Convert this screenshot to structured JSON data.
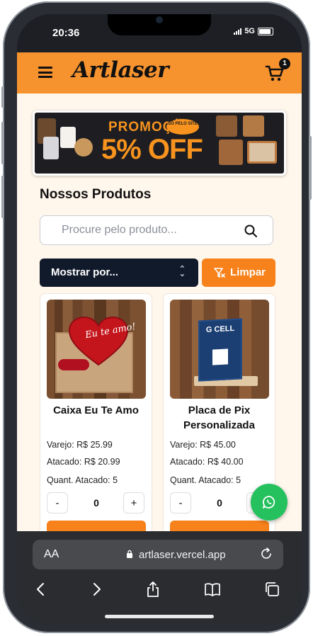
{
  "status": {
    "time": "20:36",
    "network": "5G"
  },
  "nav": {
    "logo": "Artlaser",
    "cart_count": "1"
  },
  "banner": {
    "title": "PROMOÇÃO",
    "big": "5% OFF",
    "small": "SÓ PELO SITE"
  },
  "section": {
    "title": "Nossos Produtos"
  },
  "search": {
    "placeholder": "Procure pelo produto..."
  },
  "filter": {
    "select_label": "Mostrar por...",
    "clear_label": "Limpar"
  },
  "products": [
    {
      "name": "Caixa Eu Te Amo",
      "retail": "Varejo: R$ 25.99",
      "wholesale": "Atacado: R$ 20.99",
      "wholesale_qty": "Quant. Atacado: 5",
      "quantity": "0",
      "minus": "-",
      "plus": "+",
      "image_text": "Eu te amo!"
    },
    {
      "name": "Placa de Pix Personalizada",
      "retail": "Varejo: R$ 45.00",
      "wholesale": "Atacado: R$ 40.00",
      "wholesale_qty": "Quant. Atacado: 5",
      "quantity": "0",
      "minus": "-",
      "plus": "+",
      "image_text": "G CELL"
    }
  ],
  "browser": {
    "aa": "AA",
    "url": "artlaser.vercel.app"
  },
  "colors": {
    "accent": "#f7932e",
    "button_orange": "#f7811a",
    "dark_select": "#111a2b",
    "background": "#fff6ec",
    "whatsapp": "#25c15e"
  }
}
